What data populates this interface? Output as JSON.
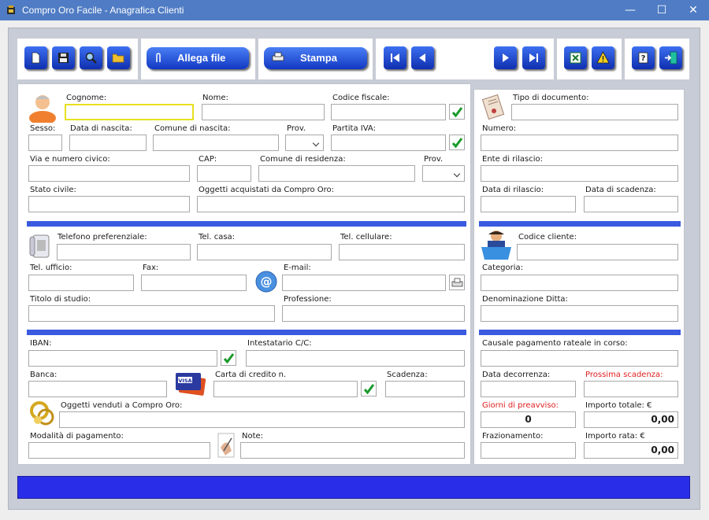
{
  "window": {
    "title": "Compro Oro Facile - Anagrafica Clienti",
    "minimize": "—",
    "maximize": "☐",
    "close": "✕"
  },
  "toolbar": {
    "allega_label": "Allega file",
    "stampa_label": "Stampa",
    "icons": [
      "new-doc-icon",
      "save-icon",
      "search-icon",
      "open-folder-icon",
      "first-record-icon",
      "prev-record-icon",
      "next-record-icon",
      "last-record-icon",
      "excel-icon",
      "warning-icon",
      "help-icon",
      "exit-icon"
    ]
  },
  "client": {
    "cognome": {
      "label": "Cognome:",
      "value": ""
    },
    "nome": {
      "label": "Nome:",
      "value": ""
    },
    "codice_fiscale": {
      "label": "Codice fiscale:",
      "value": ""
    },
    "sesso": {
      "label": "Sesso:",
      "value": ""
    },
    "data_nascita": {
      "label": "Data di nascita:",
      "value": ""
    },
    "comune_nascita": {
      "label": "Comune di nascita:",
      "value": ""
    },
    "prov_nascita": {
      "label": "Prov.",
      "value": ""
    },
    "partita_iva": {
      "label": "Partita IVA:",
      "value": ""
    },
    "via": {
      "label": "Via e numero civico:",
      "value": ""
    },
    "cap": {
      "label": "CAP:",
      "value": ""
    },
    "comune_residenza": {
      "label": "Comune di residenza:",
      "value": ""
    },
    "prov_residenza": {
      "label": "Prov.",
      "value": ""
    },
    "stato_civile": {
      "label": "Stato civile:",
      "value": ""
    },
    "oggetti_acquistati": {
      "label": "Oggetti acquistati da Compro Oro:",
      "value": ""
    }
  },
  "contacts": {
    "telefono_pref": {
      "label": "Telefono preferenziale:",
      "value": ""
    },
    "tel_casa": {
      "label": "Tel. casa:",
      "value": ""
    },
    "tel_cellulare": {
      "label": "Tel. cellulare:",
      "value": ""
    },
    "tel_ufficio": {
      "label": "Tel. ufficio:",
      "value": ""
    },
    "fax": {
      "label": "Fax:",
      "value": ""
    },
    "email": {
      "label": "E-mail:",
      "value": ""
    },
    "titolo_studio": {
      "label": "Titolo di studio:",
      "value": ""
    },
    "professione": {
      "label": "Professione:",
      "value": ""
    }
  },
  "payment": {
    "iban": {
      "label": "IBAN:",
      "value": ""
    },
    "intestatario": {
      "label": "Intestatario C/C:",
      "value": ""
    },
    "banca": {
      "label": "Banca:",
      "value": ""
    },
    "carta_credito": {
      "label": "Carta di credito n.",
      "value": ""
    },
    "scadenza": {
      "label": "Scadenza:",
      "value": ""
    },
    "oggetti_venduti": {
      "label": "Oggetti venduti a Compro Oro:",
      "value": ""
    },
    "modalita_pagamento": {
      "label": "Modalità di pagamento:",
      "value": ""
    },
    "note": {
      "label": "Note:",
      "value": ""
    }
  },
  "document": {
    "tipo": {
      "label": "Tipo di documento:",
      "value": ""
    },
    "numero": {
      "label": "Numero:",
      "value": ""
    },
    "ente": {
      "label": "Ente di rilascio:",
      "value": ""
    },
    "data_rilascio": {
      "label": "Data di rilascio:",
      "value": ""
    },
    "data_scadenza": {
      "label": "Data di scadenza:",
      "value": ""
    }
  },
  "customer": {
    "codice_cliente": {
      "label": "Codice cliente:",
      "value": ""
    },
    "categoria": {
      "label": "Categoria:",
      "value": ""
    },
    "denominazione": {
      "label": "Denominazione Ditta:",
      "value": ""
    }
  },
  "installment": {
    "causale": {
      "label": "Causale pagamento rateale in corso:",
      "value": ""
    },
    "data_decorrenza": {
      "label": "Data decorrenza:",
      "value": ""
    },
    "prossima_scadenza": {
      "label": "Prossima scadenza:",
      "value": ""
    },
    "giorni_preavviso": {
      "label": "Giorni di preavviso:",
      "value": "0"
    },
    "importo_totale": {
      "label": "Importo totale: €",
      "value": "0,00"
    },
    "frazionamento": {
      "label": "Frazionamento:",
      "value": ""
    },
    "importo_rata": {
      "label": "Importo rata: €",
      "value": "0,00"
    }
  },
  "colors": {
    "titlebar": "#4f7cc4",
    "button_blue": "#1e46d8",
    "section_bar": "#3a5ae0",
    "footer_bar": "#2a2de8",
    "focus_border": "#e8e020",
    "warning_red": "#e02020"
  }
}
